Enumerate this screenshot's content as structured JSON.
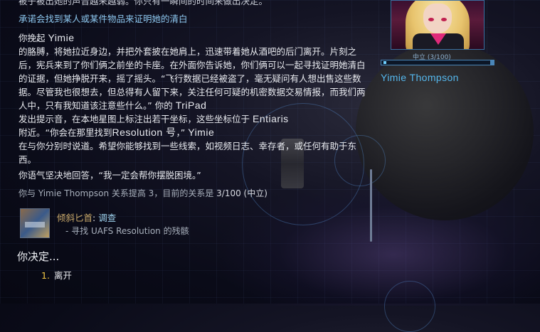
{
  "cut_line": "被子被出她的声音越来越弱。你只有一瞬间的时间来做出决定。",
  "previous_choice": "承诺会找到某人或某件物品来证明她的清白",
  "story": {
    "p1": "你挽起",
    "name1": "Yimie",
    "p2": "的胳膊，将她拉近身边，并把外套披在她肩上，迅速带着她从酒吧的后门离开。片刻之后，宪兵来到了你们俩之前坐的卡座。在外面你告诉她，你们俩可以一起寻找证明她清白的证据，但她挣脱开来，摇了摇头。“飞行数据已经被盗了，毫无疑问有人想出售这些数据。尽管我也很想去，但总得有人留下来，关注任何可疑的机密数据交易情报，而我们两人中，只有我知道该注意些什么。” 你的",
    "tripad": "TriPad",
    "p3": "发出提示音，在本地星图上标注出若干坐标，这些坐标位于",
    "entiaris": "Entiaris",
    "p4": "附近。“你会在那里找到",
    "resolution": "Resolution 号",
    "p5": "，”",
    "name2": "Yimie",
    "p6": "在与你分别时说道。希望你能够找到一些线索，如视频日志、幸存者，或任何有助于东西。"
  },
  "reply": "你语气坚决地回答，“我一定会帮你摆脱困境。”",
  "relation_change": {
    "prefix": "你与 Yimie Thompson 关系提高 3，目前的关系是",
    "value": "3/100 (中立)"
  },
  "quest": {
    "name": "倾斜匕首",
    "sep": ": ",
    "status": "调查",
    "objective": "- 寻找 UAFS Resolution 的残骸"
  },
  "decision": {
    "prompt": "你决定...",
    "options": [
      {
        "num": "1.",
        "label": "离开"
      }
    ]
  },
  "character": {
    "name": "Yimie Thompson",
    "relation_label": "中立 (3/100)",
    "relation_fraction": 0.03,
    "accent_color": "#55b8ee"
  }
}
